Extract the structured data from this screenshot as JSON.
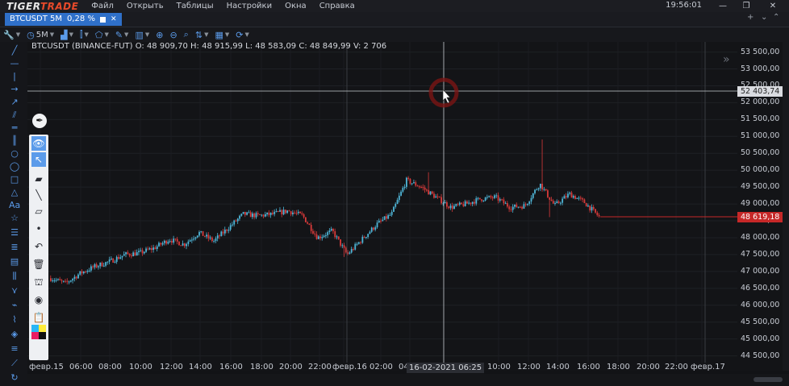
{
  "app": {
    "logo_part1": "TIGER",
    "logo_part2": "TRADE",
    "menu": [
      "Файл",
      "Открыть",
      "Таблицы",
      "Настройки",
      "Окна",
      "Справка"
    ],
    "clock": "19:56:01"
  },
  "tab": {
    "label": "BTCUSDT 5M",
    "change": "0,28 %"
  },
  "toolbar": {
    "timeframe": "5M"
  },
  "ohlc_info": "BTCUSDT (BINANCE-FUT)  O: 48 909,70  H: 48 915,99  L: 48 583,09  C: 48 849,99  V: 2 706",
  "crosshair": {
    "price_label": "52 403,74",
    "time_label": "16-02-2021 06:25"
  },
  "last_price_label": "48 619,18",
  "colors": {
    "up": "#4fb6d8",
    "down": "#d83a3a",
    "background": "#131417",
    "accent": "#2f70c9",
    "last_price": "#c62828"
  },
  "price_axis": [
    "53 500,00",
    "53 000,00",
    "52 500,00",
    "52 000,00",
    "51 500,00",
    "51 000,00",
    "50 500,00",
    "50 000,00",
    "49 500,00",
    "49 000,00",
    "48 500,00",
    "48 000,00",
    "47 500,00",
    "47 000,00",
    "46 500,00",
    "46 000,00",
    "45 500,00",
    "45 000,00",
    "44 500,00"
  ],
  "time_axis": [
    "февр.15",
    "06:00",
    "08:00",
    "10:00",
    "12:00",
    "14:00",
    "16:00",
    "18:00",
    "20:00",
    "22:00",
    "февр.16",
    "02:00",
    "04",
    "10:00",
    "12:00",
    "14:00",
    "16:00",
    "18:00",
    "20:00",
    "22:00",
    "февр.17"
  ],
  "chart_data": {
    "type": "candlestick",
    "symbol": "BTCUSDT (BINANCE-FUT)",
    "interval": "5M",
    "ylim": [
      44300,
      53800
    ],
    "last_price": 48619.18,
    "trend": [
      {
        "t": "02-15 04:00",
        "p": 46800
      },
      {
        "t": "02-15 05:00",
        "p": 46650
      },
      {
        "t": "02-15 06:00",
        "p": 46950
      },
      {
        "t": "02-15 07:00",
        "p": 47150
      },
      {
        "t": "02-15 08:00",
        "p": 47300
      },
      {
        "t": "02-15 09:00",
        "p": 47500
      },
      {
        "t": "02-15 10:00",
        "p": 47550
      },
      {
        "t": "02-15 11:00",
        "p": 47700
      },
      {
        "t": "02-15 12:00",
        "p": 47950
      },
      {
        "t": "02-15 13:00",
        "p": 47800
      },
      {
        "t": "02-15 14:00",
        "p": 48150
      },
      {
        "t": "02-15 15:00",
        "p": 47900
      },
      {
        "t": "02-15 16:00",
        "p": 48300
      },
      {
        "t": "02-15 17:00",
        "p": 48700
      },
      {
        "t": "02-15 18:00",
        "p": 48650
      },
      {
        "t": "02-15 19:00",
        "p": 48700
      },
      {
        "t": "02-15 20:00",
        "p": 48800
      },
      {
        "t": "02-15 21:00",
        "p": 48650
      },
      {
        "t": "02-15 22:00",
        "p": 48000
      },
      {
        "t": "02-15 23:00",
        "p": 48200
      },
      {
        "t": "02-16 00:00",
        "p": 47500
      },
      {
        "t": "02-16 01:00",
        "p": 47950
      },
      {
        "t": "02-16 02:00",
        "p": 48400
      },
      {
        "t": "02-16 03:00",
        "p": 48700
      },
      {
        "t": "02-16 04:00",
        "p": 49700
      },
      {
        "t": "02-16 05:00",
        "p": 49500
      },
      {
        "t": "02-16 06:00",
        "p": 49200
      },
      {
        "t": "02-16 07:00",
        "p": 48900
      },
      {
        "t": "02-16 08:00",
        "p": 49000
      },
      {
        "t": "02-16 09:00",
        "p": 49150
      },
      {
        "t": "02-16 10:00",
        "p": 49200
      },
      {
        "t": "02-16 11:00",
        "p": 48900
      },
      {
        "t": "02-16 12:00",
        "p": 48950
      },
      {
        "t": "02-16 13:00",
        "p": 49600
      },
      {
        "t": "02-16 14:00",
        "p": 48950
      },
      {
        "t": "02-16 15:00",
        "p": 49300
      },
      {
        "t": "02-16 16:00",
        "p": 49050
      },
      {
        "t": "02-16 17:00",
        "p": 48620
      }
    ]
  }
}
